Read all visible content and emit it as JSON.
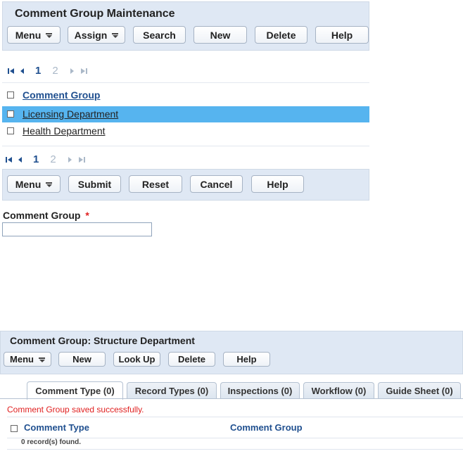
{
  "top": {
    "title": "Comment Group Maintenance",
    "buttons": {
      "menu": "Menu",
      "assign": "Assign",
      "search": "Search",
      "new": "New",
      "delete": "Delete",
      "help": "Help"
    }
  },
  "pager": {
    "pages": [
      "1",
      "2"
    ]
  },
  "list": {
    "header": "Comment Group",
    "rows": [
      "Licensing Department",
      "Health Department"
    ]
  },
  "form_bar": {
    "buttons": {
      "menu": "Menu",
      "submit": "Submit",
      "reset": "Reset",
      "cancel": "Cancel",
      "help": "Help"
    }
  },
  "form": {
    "label": "Comment Group",
    "required": "*",
    "value": ""
  },
  "detail": {
    "title": "Comment Group: Structure Department",
    "buttons": {
      "menu": "Menu",
      "new": "New",
      "lookup": "Look Up",
      "delete": "Delete",
      "help": "Help"
    },
    "tabs": [
      "Comment Type (0)",
      "Record Types (0)",
      "Inspections (0)",
      "Workflow (0)",
      "Guide Sheet (0)"
    ],
    "message": "Comment Group saved successfully.",
    "columns": [
      "Comment Type",
      "Comment Group"
    ],
    "footer": "0 record(s) found."
  },
  "colors": {
    "panel": "#dfe8f4",
    "selected_row": "#56b4ef",
    "link_blue": "#1f4f8f",
    "error_red": "#e02020"
  }
}
